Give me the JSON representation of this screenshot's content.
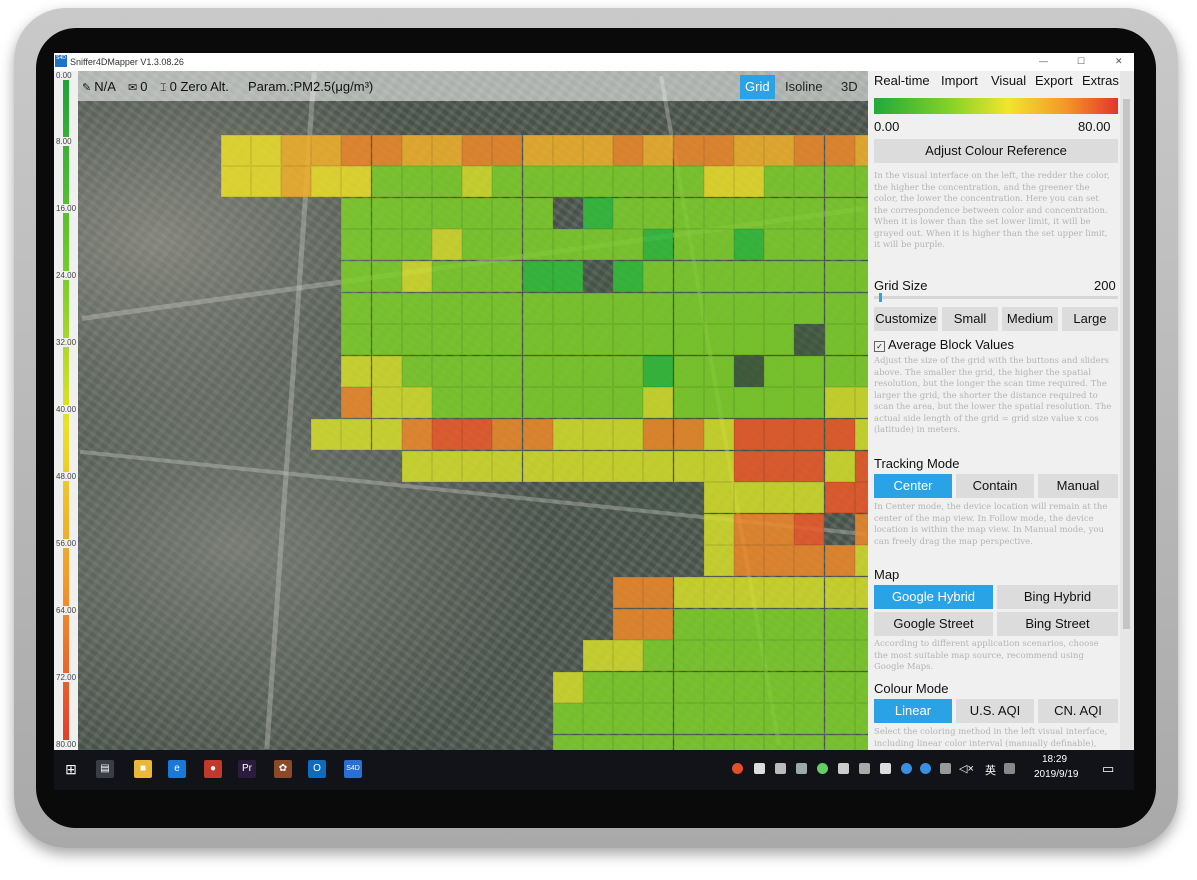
{
  "app": {
    "title": "Sniffer4DMapper V1.3.08.26",
    "icon_label": "S4D",
    "window_buttons": [
      "—",
      "☐",
      "✕"
    ]
  },
  "legend": {
    "ticks": [
      "0.00",
      "8.00",
      "16.00",
      "24.00",
      "32.00",
      "40.00",
      "48.00",
      "56.00",
      "64.00",
      "72.00",
      "80.00"
    ],
    "colors": [
      "#19a23a",
      "#6dcc2a",
      "#e8e22a",
      "#f39a2a",
      "#e23a2a"
    ]
  },
  "status": {
    "location": "N/A",
    "count": "0",
    "alt_value": "0",
    "alt_label": "Zero Alt.",
    "param": "Param.:PM2.5(μg/m³)"
  },
  "view_tabs": [
    {
      "label": "Grid",
      "active": true
    },
    {
      "label": "Isoline",
      "active": false
    },
    {
      "label": "3D",
      "active": false
    }
  ],
  "menu": [
    "Real-time",
    "Import",
    "Visual",
    "Export",
    "Extras"
  ],
  "colour_scale": {
    "min": "0.00",
    "max": "80.00",
    "adjust_button": "Adjust Colour Reference",
    "help": "In the visual interface on the left, the redder the color, the higher the concentration, and the greener the color, the lower the concentration. Here you can set the correspondence between color and concentration. When it is lower than the set lower limit, it will be grayed out. When it is higher than the set upper limit, it will be purple."
  },
  "grid_size": {
    "label": "Grid Size",
    "value": "200",
    "value_fraction": 0.01,
    "buttons": [
      "Customize",
      "Small",
      "Medium",
      "Large"
    ],
    "average_checkbox": "Average Block Values",
    "average_checked": true,
    "help": "Adjust the size of the grid with the buttons and sliders above. The smaller the grid, the higher the spatial resolution, but the longer the scan time required. The larger the grid, the shorter the distance required to scan the area, but the lower the spatial resolution. The actual side length of the grid = grid size value x cos (latitude) in meters."
  },
  "tracking": {
    "label": "Tracking Mode",
    "buttons": [
      {
        "label": "Center",
        "active": true
      },
      {
        "label": "Contain",
        "active": false
      },
      {
        "label": "Manual",
        "active": false
      }
    ],
    "help": "In Center mode, the device location will remain at the center of the map view. In Follow mode, the device location is within the map view. In Manual mode, you can freely drag the map perspective."
  },
  "map_source": {
    "label": "Map",
    "buttons": [
      {
        "label": "Google Hybrid",
        "active": true
      },
      {
        "label": "Bing Hybrid",
        "active": false
      },
      {
        "label": "Google Street",
        "active": false
      },
      {
        "label": "Bing Street",
        "active": false
      }
    ],
    "help": "According to different application scenarios, choose the most suitable map source, recommend using Google Maps."
  },
  "colour_mode": {
    "label": "Colour Mode",
    "buttons": [
      {
        "label": "Linear",
        "active": true
      },
      {
        "label": "U.S. AQI",
        "active": false
      },
      {
        "label": "CN. AQI",
        "active": false
      }
    ],
    "help": "Select the coloring method in the left visual interface, including linear color interval (manually definable), China AQI standard, and"
  },
  "taskbar": {
    "apps": [
      {
        "name": "task-view",
        "glyph": "▤",
        "color": "#3a3d44"
      },
      {
        "name": "file-explorer",
        "glyph": "■",
        "color": "#e9b73a"
      },
      {
        "name": "edge",
        "glyph": "e",
        "color": "#1a78d6"
      },
      {
        "name": "recorder",
        "glyph": "●",
        "color": "#c0392b"
      },
      {
        "name": "premiere",
        "glyph": "Pr",
        "color": "#2b1b3d"
      },
      {
        "name": "app-6",
        "glyph": "✿",
        "color": "#8a4a2a"
      },
      {
        "name": "outlook",
        "glyph": "O",
        "color": "#0f6cbd"
      },
      {
        "name": "sniffer4d",
        "glyph": "S4D",
        "color": "#2a6fd6"
      }
    ],
    "ime": "英",
    "time": "18:29",
    "date": "2019/9/19"
  }
}
